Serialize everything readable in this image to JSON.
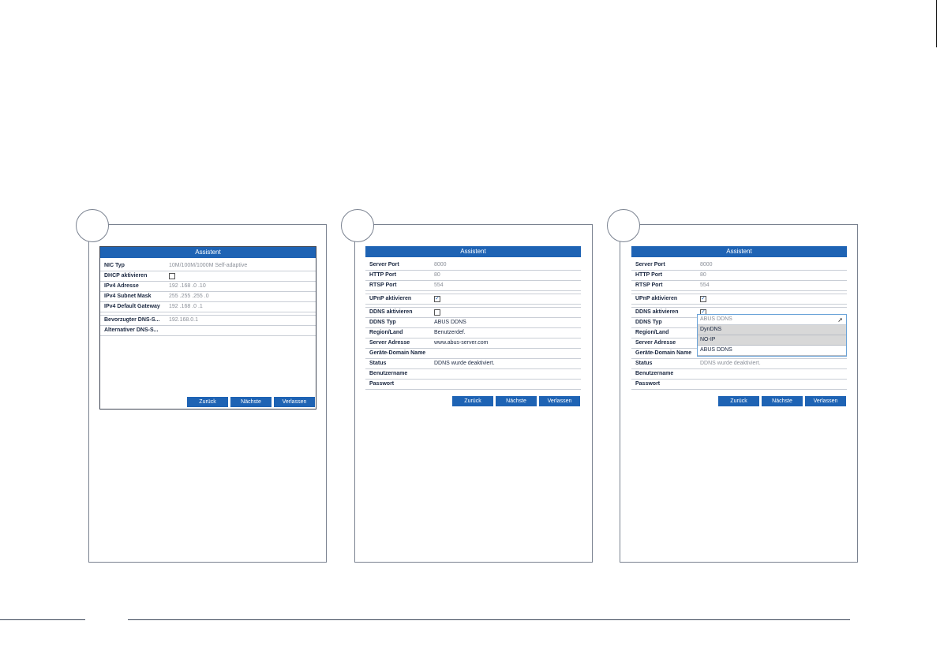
{
  "dialog_title": "Assistent",
  "buttons": {
    "back": "Zurück",
    "next": "Nächste",
    "exit": "Verlassen"
  },
  "panel1": {
    "rows": [
      {
        "label": "NIC Typ",
        "value": "10M/100M/1000M Self-adaptive"
      },
      {
        "label": "DHCP aktivieren",
        "value": ""
      },
      {
        "label": "IPv4 Adresse",
        "value": "192 .168 .0    .10"
      },
      {
        "label": "IPv4 Subnet Mask",
        "value": "255 .255 .255 .0"
      },
      {
        "label": "IPv4 Default Gateway",
        "value": "192 .168 .0    .1"
      },
      {
        "label": "Bevorzugter DNS-S...",
        "value": "192.168.0.1"
      },
      {
        "label": "Alternativer DNS-S...",
        "value": ""
      }
    ]
  },
  "panel2": {
    "rows": [
      {
        "label": "Server Port",
        "value": "8000"
      },
      {
        "label": "HTTP Port",
        "value": "80"
      },
      {
        "label": "RTSP Port",
        "value": "554"
      },
      {
        "label": "UPnP aktivieren",
        "value": ""
      },
      {
        "label": "DDNS aktivieren",
        "value": ""
      },
      {
        "label": "DDNS Typ",
        "value": "ABUS DDNS"
      },
      {
        "label": "Region/Land",
        "value": "Benutzerdef."
      },
      {
        "label": "Server Adresse",
        "value": "www.abus-server.com"
      },
      {
        "label": "Geräte-Domain Name",
        "value": ""
      },
      {
        "label": "Status",
        "value": "DDNS wurde deaktiviert."
      },
      {
        "label": "Benutzername",
        "value": ""
      },
      {
        "label": "Passwort",
        "value": ""
      }
    ]
  },
  "panel3": {
    "rows": [
      {
        "label": "Server Port",
        "value": "8000"
      },
      {
        "label": "HTTP Port",
        "value": "80"
      },
      {
        "label": "RTSP Port",
        "value": "554"
      },
      {
        "label": "UPnP aktivieren",
        "value": ""
      },
      {
        "label": "DDNS aktivieren",
        "value": ""
      },
      {
        "label": "DDNS Typ",
        "value": ""
      },
      {
        "label": "Region/Land",
        "value": ""
      },
      {
        "label": "Server Adresse",
        "value": ""
      },
      {
        "label": "Geräte-Domain Name",
        "value": ""
      },
      {
        "label": "Status",
        "value": "DDNS wurde deaktiviert."
      },
      {
        "label": "Benutzername",
        "value": ""
      },
      {
        "label": "Passwort",
        "value": ""
      }
    ],
    "dropdown": {
      "selected": "ABUS DDNS",
      "options": [
        "DynDNS",
        "NO-IP",
        "ABUS DDNS"
      ]
    }
  },
  "colors": {
    "accent": "#1e63b4",
    "border": "#7a8290"
  }
}
